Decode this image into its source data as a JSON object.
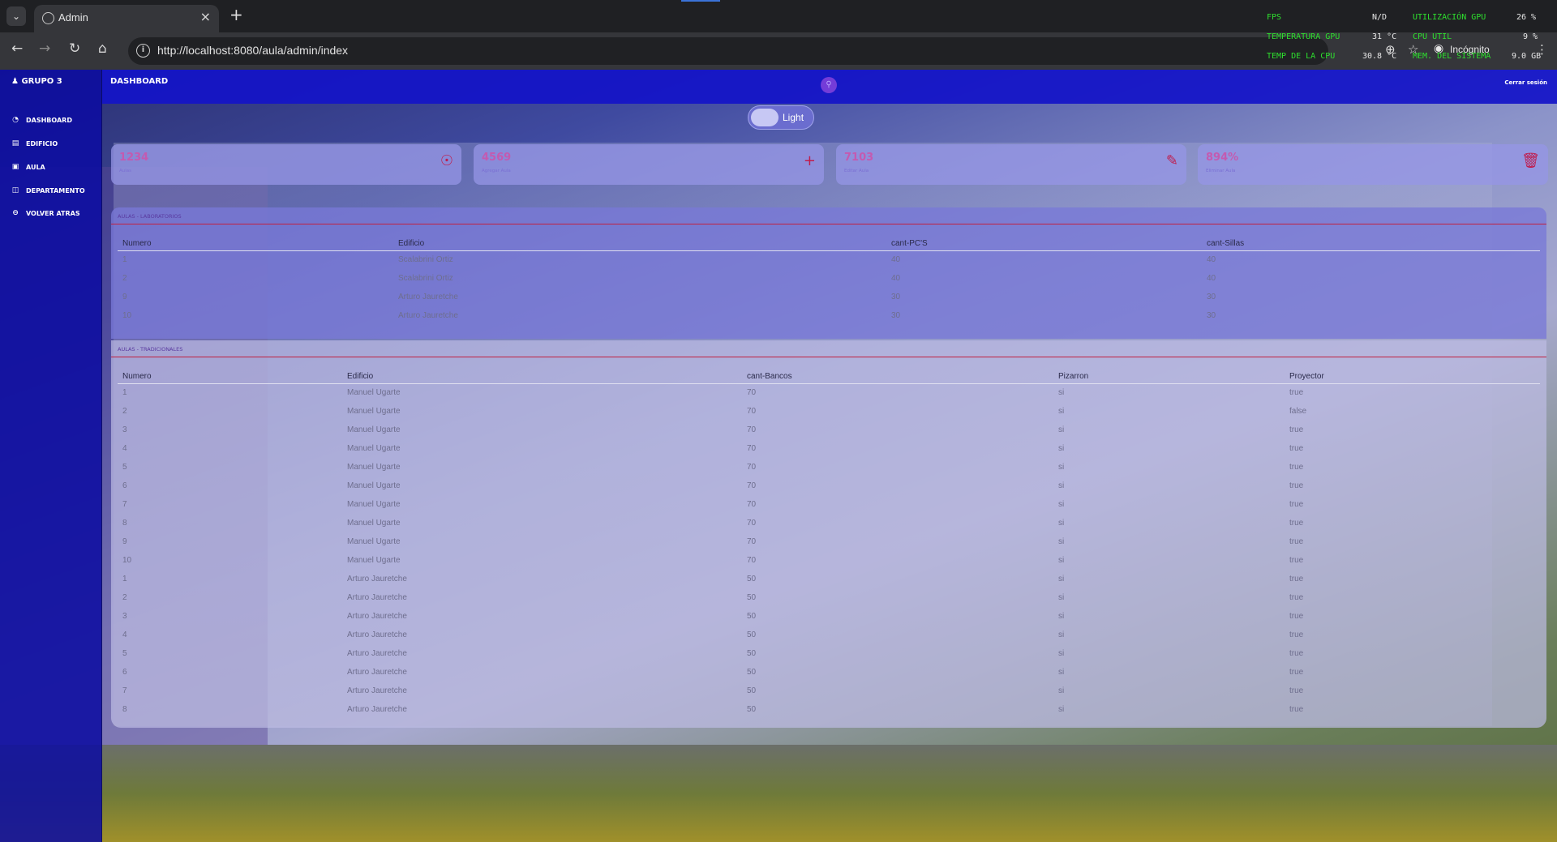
{
  "browser": {
    "tab_title": "Admin",
    "url": "http://localhost:8080/aula/admin/index",
    "incognito_label": "Incógnito"
  },
  "overlay": {
    "fps_label": "FPS",
    "fps_value": "N/D",
    "gpu_util_label": "UTILIZACIÓN GPU",
    "gpu_util_value": "26 %",
    "gpu_temp_label": "TEMPERATURA GPU",
    "gpu_temp_value": "31 °C",
    "cpu_util_label": "CPU UTIL",
    "cpu_util_value": "9 %",
    "cpu_temp_label": "TEMP DE LA CPU",
    "cpu_temp_value": "30.8 °C",
    "mem_label": "MEM. DEL SISTEMA",
    "mem_value": "9.0 GB"
  },
  "sidebar": {
    "brand": "GRUPO 3",
    "items": [
      {
        "label": "DASHBOARD"
      },
      {
        "label": "EDIFICIO"
      },
      {
        "label": "AULA"
      },
      {
        "label": "DEPARTAMENTO"
      },
      {
        "label": "VOLVER ATRAS"
      }
    ]
  },
  "header": {
    "title": "DASHBOARD",
    "logout": "Cerrar sesión"
  },
  "theme_toggle": {
    "label": "Light"
  },
  "cards": [
    {
      "value": "1234",
      "label": "Aulas"
    },
    {
      "value": "4569",
      "label": "Agregar Aula"
    },
    {
      "value": "7103",
      "label": "Editar Aula"
    },
    {
      "value": "894%",
      "label": "Eliminar Aula"
    }
  ],
  "labs": {
    "title": "AULAS - LABORATORIOS",
    "headers": [
      "Numero",
      "Edificio",
      "cant-PC'S",
      "cant-Sillas"
    ],
    "rows": [
      [
        "1",
        "Scalabrini Ortiz",
        "40",
        "40"
      ],
      [
        "2",
        "Scalabrini Ortiz",
        "40",
        "40"
      ],
      [
        "9",
        "Arturo Jauretche",
        "30",
        "30"
      ],
      [
        "10",
        "Arturo Jauretche",
        "30",
        "30"
      ]
    ]
  },
  "traditional": {
    "title": "AULAS - TRADICIONALES",
    "headers": [
      "Numero",
      "Edificio",
      "cant-Bancos",
      "Pizarron",
      "Proyector"
    ],
    "rows": [
      [
        "1",
        "Manuel Ugarte",
        "70",
        "si",
        "true"
      ],
      [
        "2",
        "Manuel Ugarte",
        "70",
        "si",
        "false"
      ],
      [
        "3",
        "Manuel Ugarte",
        "70",
        "si",
        "true"
      ],
      [
        "4",
        "Manuel Ugarte",
        "70",
        "si",
        "true"
      ],
      [
        "5",
        "Manuel Ugarte",
        "70",
        "si",
        "true"
      ],
      [
        "6",
        "Manuel Ugarte",
        "70",
        "si",
        "true"
      ],
      [
        "7",
        "Manuel Ugarte",
        "70",
        "si",
        "true"
      ],
      [
        "8",
        "Manuel Ugarte",
        "70",
        "si",
        "true"
      ],
      [
        "9",
        "Manuel Ugarte",
        "70",
        "si",
        "true"
      ],
      [
        "10",
        "Manuel Ugarte",
        "70",
        "si",
        "true"
      ],
      [
        "1",
        "Arturo Jauretche",
        "50",
        "si",
        "true"
      ],
      [
        "2",
        "Arturo Jauretche",
        "50",
        "si",
        "true"
      ],
      [
        "3",
        "Arturo Jauretche",
        "50",
        "si",
        "true"
      ],
      [
        "4",
        "Arturo Jauretche",
        "50",
        "si",
        "true"
      ],
      [
        "5",
        "Arturo Jauretche",
        "50",
        "si",
        "true"
      ],
      [
        "6",
        "Arturo Jauretche",
        "50",
        "si",
        "true"
      ],
      [
        "7",
        "Arturo Jauretche",
        "50",
        "si",
        "true"
      ],
      [
        "8",
        "Arturo Jauretche",
        "50",
        "si",
        "true"
      ]
    ]
  }
}
